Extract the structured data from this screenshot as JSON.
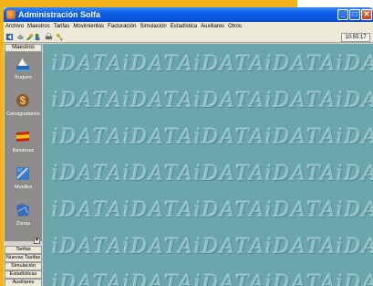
{
  "window": {
    "title": "Administración Solfa",
    "minimize": "_",
    "maximize": "□",
    "close": "✕"
  },
  "menu": [
    "Archivo",
    "Maestros",
    "Tarifas",
    "Movimientos",
    "Facturación",
    "Simulación",
    "Estadística",
    "Auxiliares",
    "Otros"
  ],
  "toolbar": {
    "icons": [
      "back-arrow-icon",
      "refresh-icon",
      "tools-icon",
      "users-icon",
      "printer-icon",
      "key-icon"
    ],
    "clock": "10:55:17"
  },
  "sidebar": {
    "header": "Maestros",
    "items": [
      {
        "label": "Buques",
        "icon": "ship-icon"
      },
      {
        "label": "Consignatarios",
        "icon": "dollar-icon"
      },
      {
        "label": "Banderas",
        "icon": "flag-icon"
      },
      {
        "label": "Muelles",
        "icon": "pier-icon"
      },
      {
        "label": "Zonas",
        "icon": "map-zone-icon"
      }
    ],
    "bottom_buttons": [
      "Tarifas",
      "Nuevas Tasifas",
      "Simulación",
      "Estadísticas",
      "Auxiliares"
    ]
  },
  "desktop": {
    "watermark": "iDATA"
  }
}
